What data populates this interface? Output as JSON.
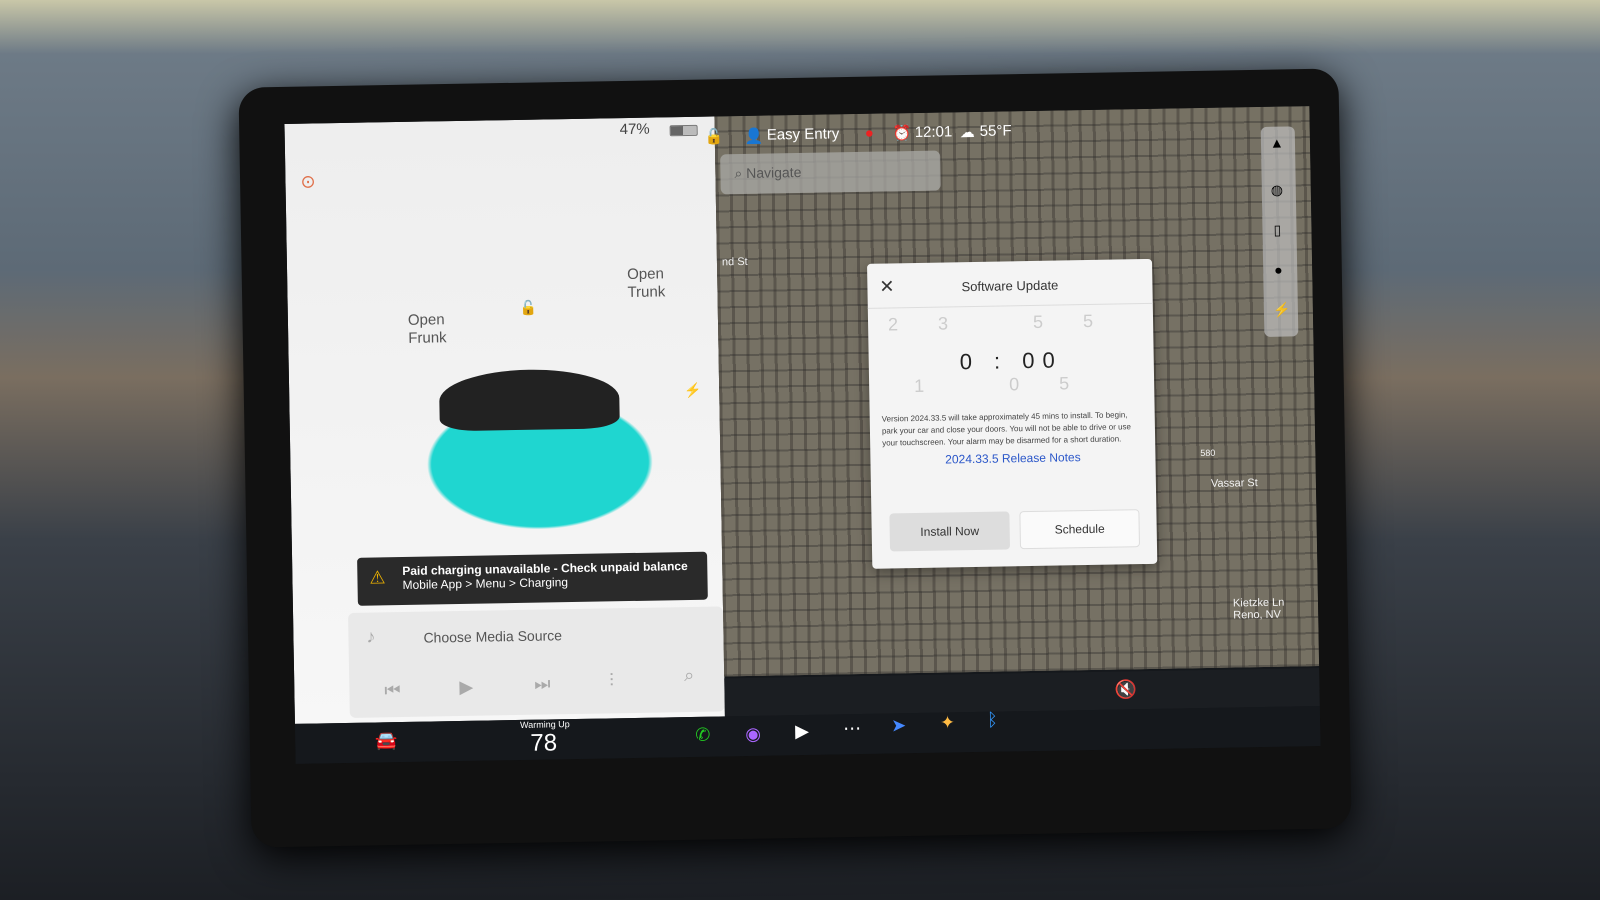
{
  "status": {
    "battery": "47%",
    "battery_level": 0.47,
    "profile": "Easy Entry",
    "time": "12:01",
    "temperature": "55°F"
  },
  "navigate": {
    "placeholder": "Navigate"
  },
  "car": {
    "open_frunk": "Open Frunk",
    "open_trunk": "Open Trunk",
    "color": "#1fd6d0"
  },
  "alert": {
    "title": "Paid charging unavailable - Check unpaid balance",
    "path": "Mobile App > Menu > Charging"
  },
  "media": {
    "source": "Choose Media Source"
  },
  "dialog": {
    "title": "Software Update",
    "hour": "0",
    "minute": "00",
    "hour_prev": "23",
    "minute_prev": "55",
    "hour_next": "1",
    "minute_next": "05",
    "description": "Version 2024.33.5 will take approximately 45 mins to install. To begin, park your car and close your doors. You will not be able to drive or use your touchscreen. Your alarm may be disarmed for a short duration.",
    "release_notes": "2024.33.5 Release Notes",
    "install_now": "Install Now",
    "schedule": "Schedule"
  },
  "climate": {
    "label": "Warming Up",
    "temp": "78"
  },
  "map_labels": [
    "nd St",
    "Vassar St",
    "Kietzke Ln Reno, NV",
    "580"
  ]
}
